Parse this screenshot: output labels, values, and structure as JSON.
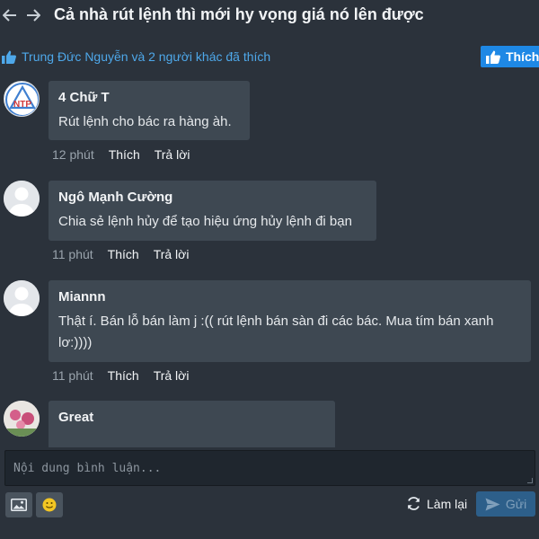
{
  "header": {
    "title": "Cả nhà rút lệnh thì mới hy vọng giá nó lên được"
  },
  "likes": {
    "summary": "Trung Đức Nguyễn và 2 người khác đã thích",
    "like_button_label": "Thích",
    "accent_color": "#1e88e5"
  },
  "comments": [
    {
      "author": "4 Chữ T",
      "text": "Rút lệnh cho bác ra hàng àh.",
      "time": "12 phút",
      "like_label": "Thích",
      "reply_label": "Trả lời",
      "avatar": "ntp-logo"
    },
    {
      "author": "Ngô Mạnh Cường",
      "text": "Chia sẻ lệnh hủy để tạo hiệu ứng hủy lệnh đi bạn",
      "time": "11 phút",
      "like_label": "Thích",
      "reply_label": "Trả lời",
      "avatar": "default-user"
    },
    {
      "author": "Miannn",
      "text": "Thật í. Bán lỗ bán làm j :(( rút lệnh bán sàn đi các bác. Mua tím bán xanh lơ:))))",
      "time": "11 phút",
      "like_label": "Thích",
      "reply_label": "Trả lời",
      "avatar": "default-user"
    },
    {
      "author": "Great",
      "text": "",
      "avatar": "photo"
    }
  ],
  "composer": {
    "placeholder": "Nội dung bình luận...",
    "reset_label": "Làm lại",
    "send_label": "Gửi",
    "image_button_icon": "image-icon",
    "emoji_button_icon": "emoji-icon"
  }
}
